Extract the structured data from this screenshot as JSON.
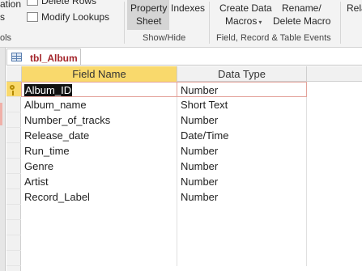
{
  "ribbon": {
    "partial_left_top": "ation",
    "partial_left_mid": "s",
    "delete_rows": "Delete Rows",
    "modify_lookups": "Modify Lookups",
    "partial_tools_label": "ols",
    "property_sheet_line1": "Property",
    "property_sheet_line2": "Sheet",
    "indexes": "Indexes",
    "show_hide_label": "Show/Hide",
    "create_data_macros_line1": "Create Data",
    "create_data_macros_line2": "Macros",
    "rename_delete_line1": "Rename/",
    "rename_delete_line2": "Delete Macro",
    "field_record_label": "Field, Record & Table Events",
    "partial_right": "Rela"
  },
  "document_tab": {
    "title": "tbl_Album"
  },
  "grid": {
    "columns": {
      "field_name": "Field Name",
      "data_type": "Data Type",
      "description": ""
    },
    "rows": [
      {
        "field": "Album_ID",
        "type": "Number",
        "primary_key": true
      },
      {
        "field": "Album_name",
        "type": "Short Text"
      },
      {
        "field": "Number_of_tracks",
        "type": "Number"
      },
      {
        "field": "Release_date",
        "type": "Date/Time"
      },
      {
        "field": "Run_time",
        "type": "Number"
      },
      {
        "field": "Genre",
        "type": "Number"
      },
      {
        "field": "Artist",
        "type": "Number"
      },
      {
        "field": "Record_Label",
        "type": "Number"
      }
    ]
  },
  "colors": {
    "ribbon_bg": "#f3f3f3",
    "header_highlight": "#f9d96c",
    "tab_title": "#a4262c",
    "key_icon": "#b58a00",
    "active_cell_border": "#e3a29a"
  },
  "icons": {
    "table": "table-icon",
    "primary_key": "key-icon",
    "delete_rows": "delete-rows-icon",
    "modify_lookups": "modify-lookups-icon"
  }
}
